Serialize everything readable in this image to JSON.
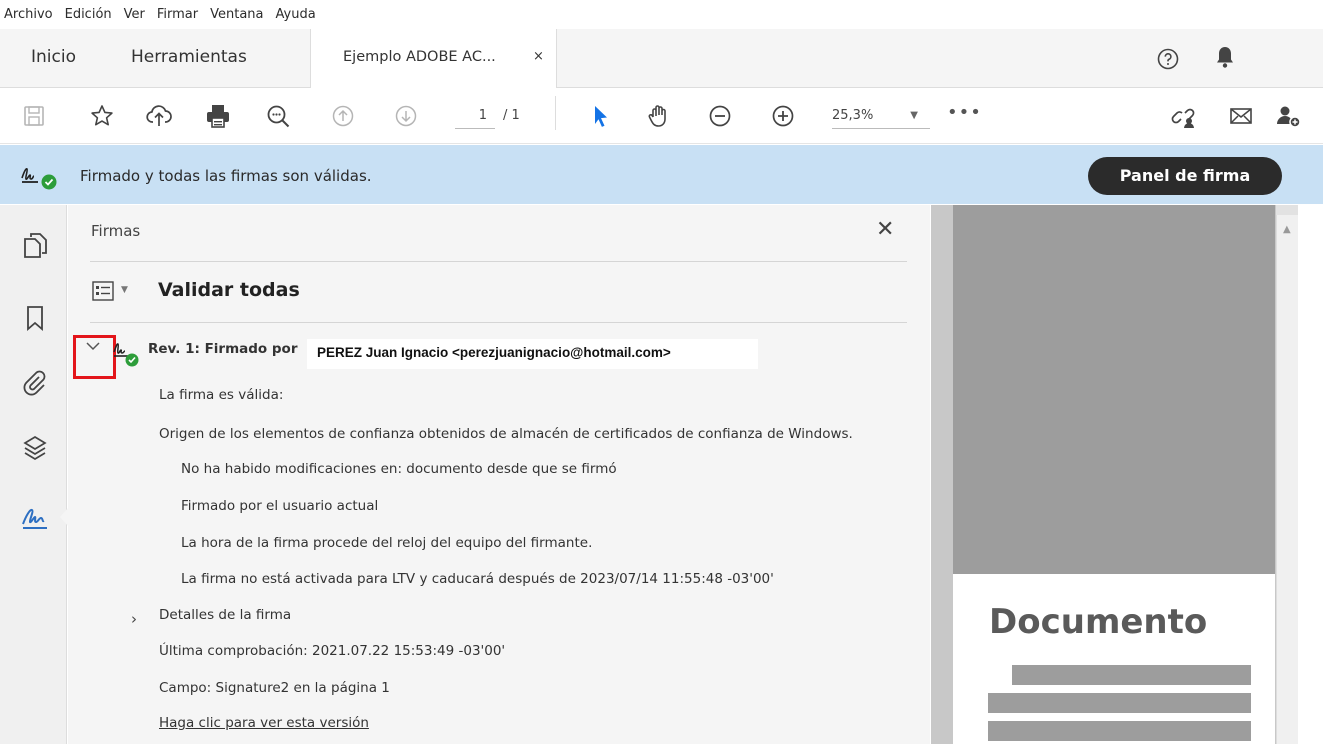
{
  "menu": [
    "Archivo",
    "Edición",
    "Ver",
    "Firmar",
    "Ventana",
    "Ayuda"
  ],
  "tabs": {
    "home": "Inicio",
    "tools": "Herramientas",
    "document": "Ejemplo ADOBE AC...",
    "close_glyph": "×"
  },
  "toolbar": {
    "page_current": "1",
    "page_total": "/ 1",
    "zoom": "25,3%",
    "zoom_caret": "▼",
    "more": "•••"
  },
  "signature_bar": {
    "status": "Firmado y todas las firmas son válidas.",
    "panel_button": "Panel de firma"
  },
  "panel": {
    "title": "Firmas",
    "close_glyph": "✕",
    "validate_all": "Validar todas",
    "list_caret": "▼",
    "revision": {
      "label": "Rev. 1: Firmado por",
      "signer": "PEREZ Juan Ignacio <perezjuanignacio@hotmail.com>"
    },
    "details": [
      "La firma es válida:",
      "Origen de los elementos de confianza obtenidos de almacén de certificados de confianza de Windows.",
      "No ha habido modificaciones en: documento desde que se firmó",
      "Firmado por el usuario actual",
      "La hora de la firma procede del reloj del equipo del firmante.",
      "La firma no está activada para LTV y caducará después de 2023/07/14 11:55:48 -03'00'"
    ],
    "signature_details": "Detalles de la firma",
    "details_chevron": "›",
    "last_check": "Última comprobación: 2021.07.22 15:53:49 -03'00'",
    "field": "Campo: Signature2 en la página 1",
    "view_version": "Haga clic para ver esta versión"
  },
  "document": {
    "heading": "Documento",
    "scroll_up": "▲"
  },
  "colors": {
    "status_bar": "#c8e0f4",
    "panel_button": "#2b2b2b",
    "cursor_active": "#1473e6",
    "valid_check": "#2d9d3a",
    "highlight_box": "#e3151a"
  }
}
